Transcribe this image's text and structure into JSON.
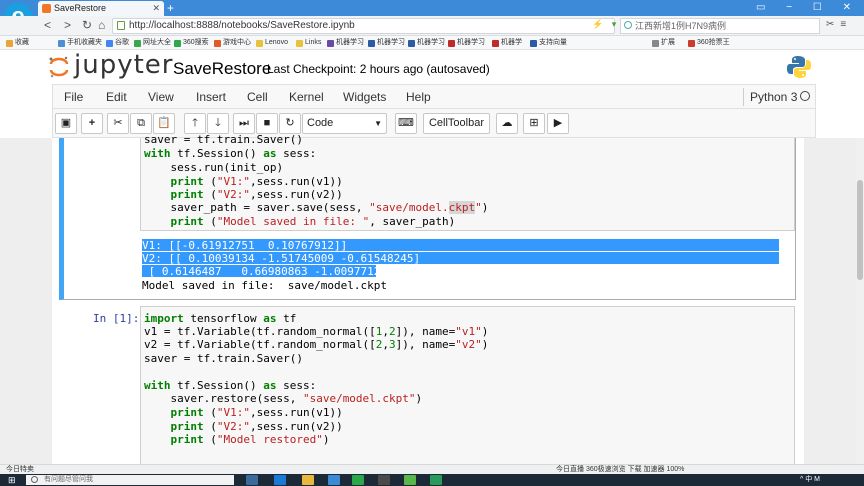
{
  "browser": {
    "tab_title": "SaveRestore",
    "new_tab": "+",
    "window_controls": "▭ − ☐ ✕",
    "url": "http://localhost:8888/notebooks/SaveRestore.ipynb",
    "search_placeholder": "江西新增1例H7N9病例",
    "bookmarks": [
      "收藏",
      "手机收藏夹",
      "谷歌",
      "网址大全",
      "360搜索",
      "游戏中心",
      "Lenovo",
      "Links",
      "机器学习",
      "机器学习",
      "机器学习",
      "机器学习",
      "机器学",
      "支持向量"
    ],
    "bookmarks_right": [
      "扩展",
      "360抢票王"
    ]
  },
  "jupyter": {
    "logo_text": "jupyter",
    "notebook_name": "SaveRestore",
    "checkpoint": "Last Checkpoint: 2 hours ago (autosaved)",
    "menus": [
      "File",
      "Edit",
      "View",
      "Insert",
      "Cell",
      "Kernel",
      "Widgets",
      "Help"
    ],
    "kernel_name": "Python 3",
    "cell_type": "Code",
    "celltoolbar_label": "CellToolbar"
  },
  "cell1": {
    "code_lines": [
      "saver = tf.train.Saver()",
      "with tf.Session() as sess:",
      "    sess.run(init_op)",
      "    print (\"V1:\",sess.run(v1))",
      "    print (\"V2:\",sess.run(v2))",
      "    saver_path = saver.save(sess, \"save/model.ckpt\")",
      "    print (\"Model saved in file: \", saver_path)"
    ],
    "output_lines": [
      "V1: [[-0.61912751  0.10767912]]",
      "V2: [[ 0.10039134 -1.51745009 -0.61548245]",
      " [ 0.6146487   0.66980863 -1.00977123]]",
      "Model saved in file:  save/model.ckpt"
    ]
  },
  "cell2": {
    "prompt": "In [1]:",
    "code_lines": [
      "import tensorflow as tf",
      "v1 = tf.Variable(tf.random_normal([1,2]), name=\"v1\")",
      "v2 = tf.Variable(tf.random_normal([2,3]), name=\"v2\")",
      "saver = tf.train.Saver()",
      "",
      "with tf.Session() as sess:",
      "    saver.restore(sess, \"save/model.ckpt\")",
      "    print (\"V1:\",sess.run(v1))",
      "    print (\"V2:\",sess.run(v2))",
      "    print (\"Model restored\")"
    ]
  },
  "statusbar": {
    "left": "今日特卖",
    "right": "今日直播   360极速浏览   下载   加速器   100%"
  },
  "taskbar": {
    "search_placeholder": "有问题尽管问我",
    "tray": "^  中  M"
  }
}
